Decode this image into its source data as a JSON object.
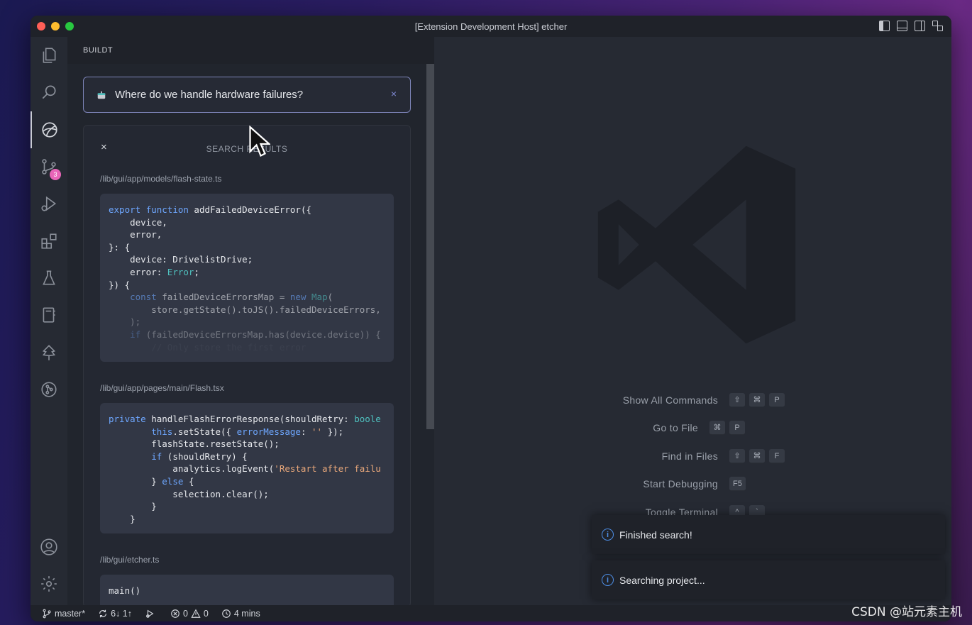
{
  "window": {
    "title": "[Extension Development Host] etcher"
  },
  "sidebar": {
    "title": "BUILDT"
  },
  "activity_bar": {
    "items": [
      "explorer",
      "search",
      "buildt",
      "source-control",
      "run-debug",
      "extensions",
      "testing",
      "notebook",
      "tree",
      "git-graph"
    ],
    "source_control_badge": "3",
    "bottom": [
      "account",
      "settings"
    ]
  },
  "query": {
    "text": "Where do we handle hardware failures?",
    "close": "×"
  },
  "results": {
    "close": "×",
    "title": "SEARCH RESULTS",
    "files": [
      {
        "path": "/lib/gui/app/models/flash-state.ts"
      },
      {
        "path": "/lib/gui/app/pages/main/Flash.tsx"
      },
      {
        "path": "/lib/gui/etcher.ts"
      }
    ]
  },
  "editor": {
    "shortcuts": [
      {
        "label": "Show All Commands",
        "keys": [
          "⇧",
          "⌘",
          "P"
        ]
      },
      {
        "label": "Go to File",
        "keys": [
          "⌘",
          "P"
        ]
      },
      {
        "label": "Find in Files",
        "keys": [
          "⇧",
          "⌘",
          "F"
        ]
      },
      {
        "label": "Start Debugging",
        "keys": [
          "F5"
        ]
      },
      {
        "label": "Toggle Terminal",
        "keys": [
          "^",
          "`"
        ]
      }
    ],
    "toasts": [
      {
        "text": "Finished search!"
      },
      {
        "text": "Searching project..."
      }
    ]
  },
  "statusbar": {
    "branch": "master*",
    "sync": "6↓ 1↑",
    "errors": "0",
    "warnings": "0",
    "time": "4 mins"
  },
  "watermark": "CSDN @站元素主机",
  "colors": {
    "accent": "#7d84b8",
    "keyword": "#6ea7ff",
    "type": "#4fc1bf",
    "string": "#e8a77a",
    "badge": "#e865b8",
    "info": "#4d8ee6"
  }
}
